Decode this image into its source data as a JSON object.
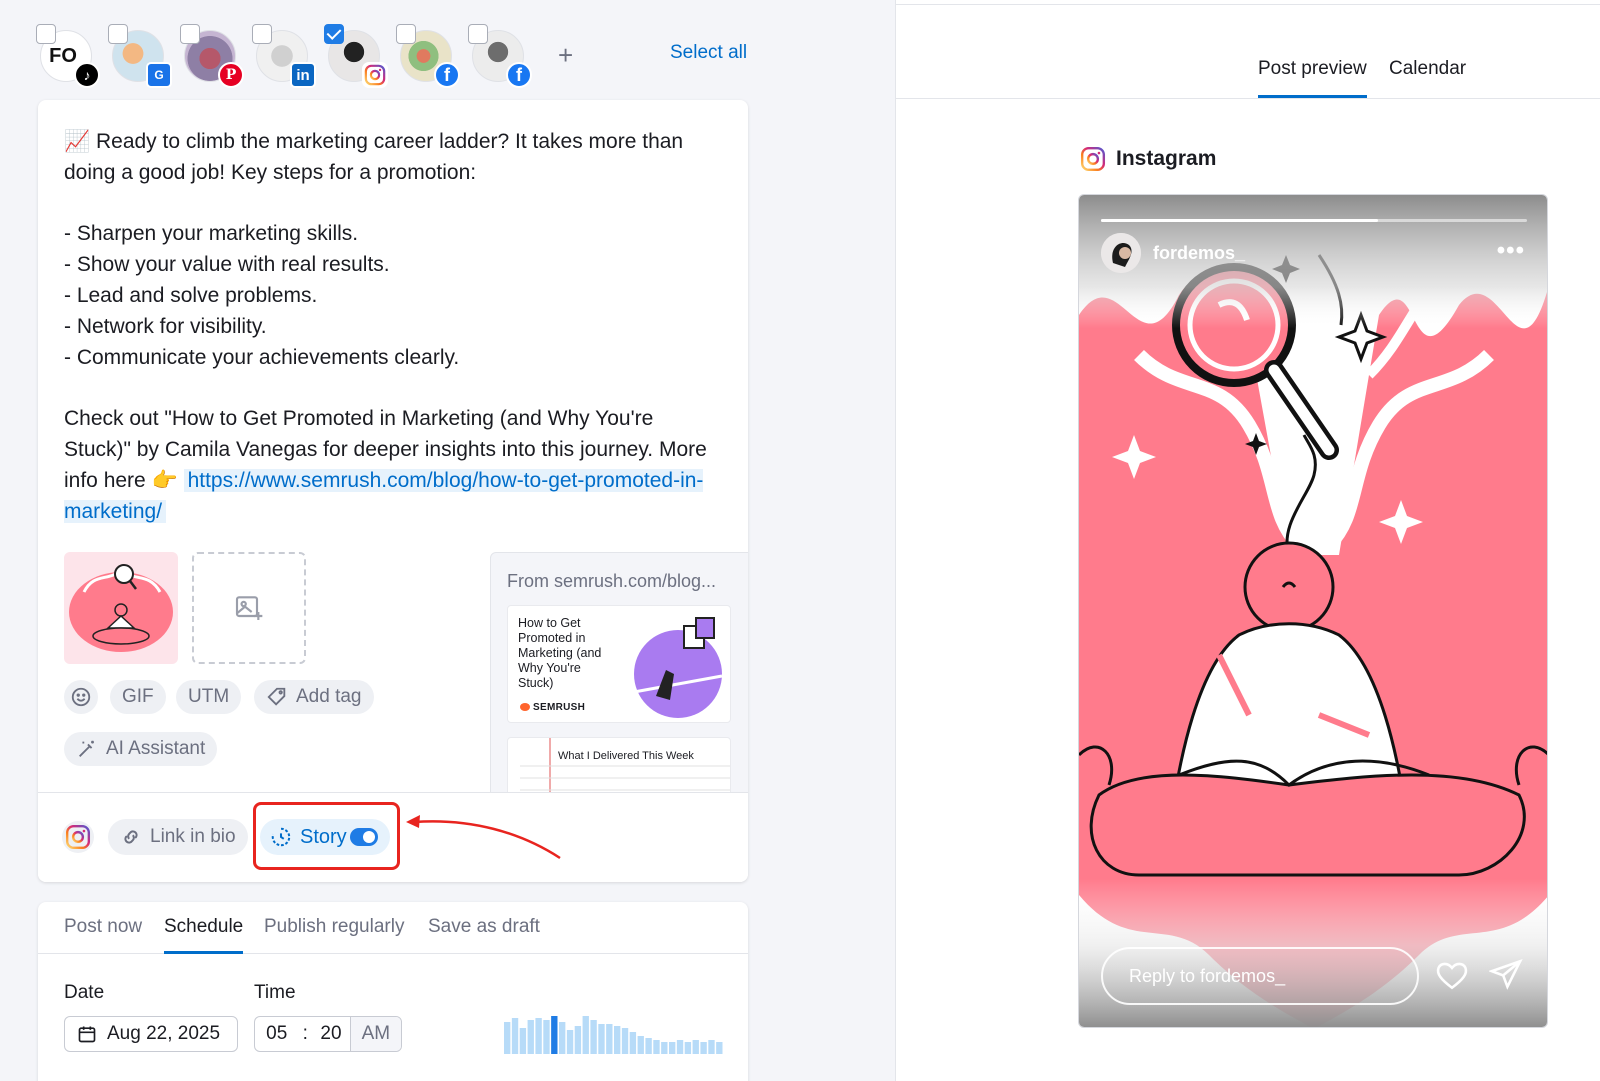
{
  "profiles": [
    {
      "initials": "FO",
      "network": "tiktok",
      "checked": false
    },
    {
      "network": "google-business",
      "checked": false
    },
    {
      "network": "pinterest",
      "checked": false
    },
    {
      "network": "linkedin",
      "checked": false
    },
    {
      "network": "instagram",
      "checked": true
    },
    {
      "network": "facebook",
      "checked": false
    },
    {
      "network": "facebook",
      "checked": false
    }
  ],
  "profiles_bar": {
    "add_label": "+",
    "select_all_label": "Select all"
  },
  "post": {
    "line1": "📈 Ready to climb the marketing career ladder? It takes more than doing a good job! Key steps for a promotion:",
    "bullets": [
      "- Sharpen your marketing skills.",
      "- Show your value with real results.",
      "- Lead and solve problems.",
      "- Network for visibility.",
      "- Communicate your achievements clearly."
    ],
    "closing": "Check out \"How to Get Promoted in Marketing (and Why You're Stuck)\" by Camila Vanegas for deeper insights into this journey. More info here 👉",
    "link": "https://www.semrush.com/blog/how-to-get-promoted-in-marketing/"
  },
  "toolbar": {
    "gif": "GIF",
    "utm": "UTM",
    "add_tag": "Add tag",
    "ai_assistant": "AI Assistant"
  },
  "link_preview": {
    "title": "From semrush.com/blog...",
    "card1_title": "How to Get Promoted in Marketing (and Why You're Stuck)",
    "card1_brand": "SEMRUSH",
    "card2_title": "What I Delivered This Week"
  },
  "channel_options": {
    "link_in_bio": "Link in bio",
    "story": "Story",
    "story_enabled": true
  },
  "schedule": {
    "tabs": [
      "Post now",
      "Schedule",
      "Publish regularly",
      "Save as draft"
    ],
    "active_tab": "Schedule",
    "date_label": "Date",
    "time_label": "Time",
    "date_value": "Aug 22, 2025",
    "hour": "05",
    "separator": ":",
    "minute": "20",
    "ampm": "AM",
    "activity_levels": [
      0.8,
      0.9,
      0.65,
      0.85,
      0.9,
      0.85,
      0.95,
      0.8,
      0.6,
      0.7,
      0.95,
      0.85,
      0.75,
      0.75,
      0.7,
      0.65,
      0.55,
      0.45,
      0.4,
      0.35,
      0.3,
      0.3,
      0.35,
      0.3,
      0.35,
      0.3,
      0.35,
      0.3
    ],
    "activity_highlight_index": 6
  },
  "right_panel": {
    "tabs": [
      "Post preview",
      "Calendar"
    ],
    "active_tab": "Post preview",
    "network_name": "Instagram"
  },
  "story_preview": {
    "username": "fordemos_",
    "more": "•••",
    "reply_placeholder": "Reply to fordemos_",
    "progress": 0.65
  },
  "colors": {
    "accent": "#006dca",
    "story_pink": "#ff7b8c",
    "highlight_red": "#e8241f"
  }
}
